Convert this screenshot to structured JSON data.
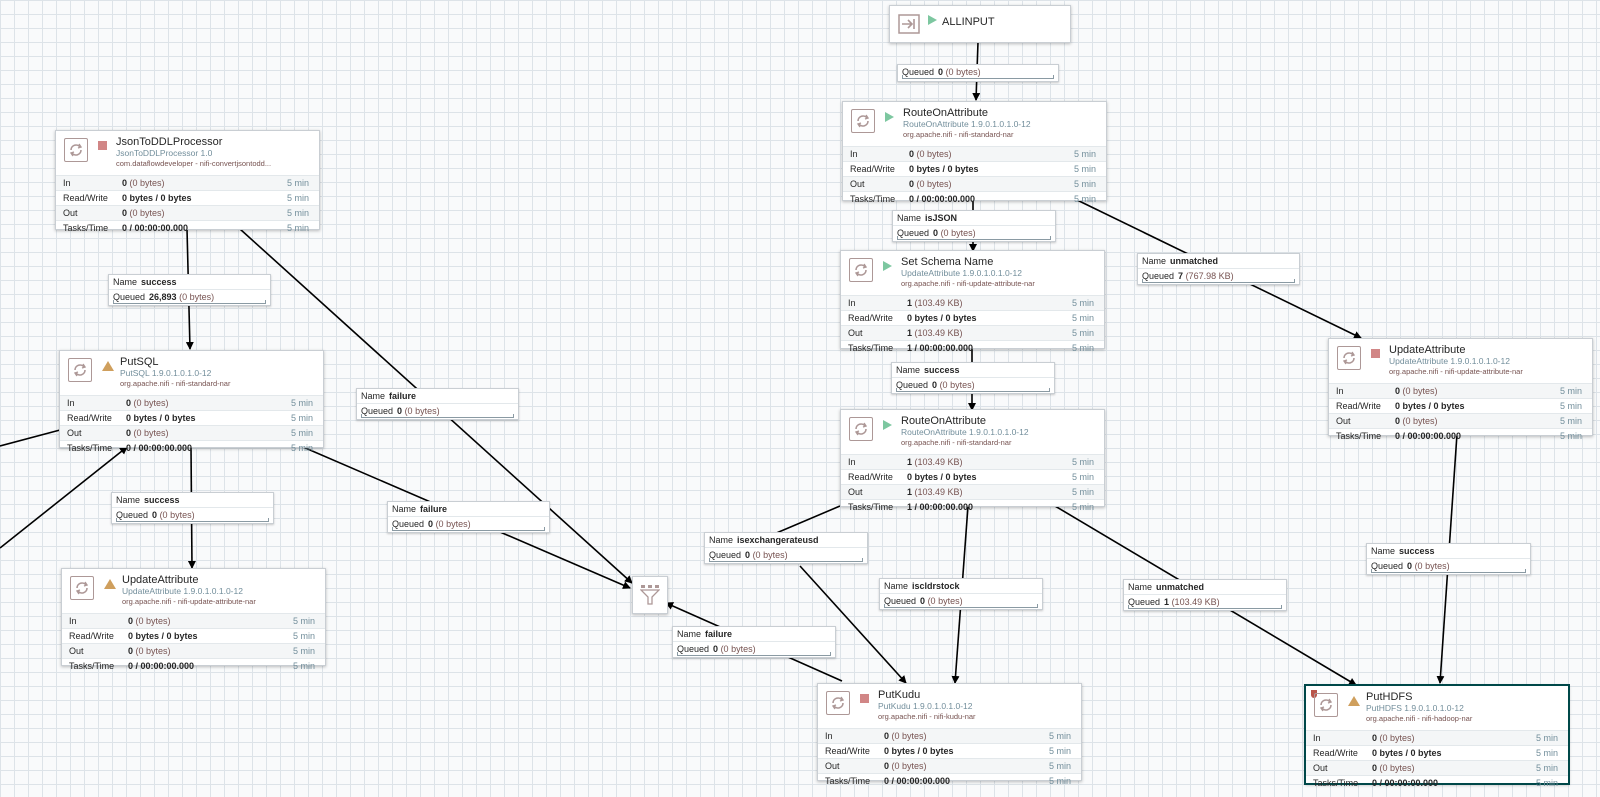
{
  "colors": {
    "running": "#7dc7a0",
    "stopped": "#d18686",
    "invalid": "#cf9f5d",
    "type_text": "#728e9b",
    "bundle_text": "#775351"
  },
  "stat_labels": {
    "in": "In",
    "rw": "Read/Write",
    "out": "Out",
    "tasks": "Tasks/Time"
  },
  "window": "5 min",
  "port_allinput": {
    "name": "ALLINPUT",
    "status": "running",
    "icon": "input-port-icon"
  },
  "processors": {
    "jsontoddl": {
      "name": "JsonToDDLProcessor",
      "status": "stopped",
      "icon": "processor-icon",
      "type": "JsonToDDLProcessor 1.0",
      "bundle": "com.dataflowdeveloper - nifi-convertjsontodd...",
      "in_count": "0",
      "in_size": "(0 bytes)",
      "rw": "0 bytes / 0 bytes",
      "out_count": "0",
      "out_size": "(0 bytes)",
      "tasks": "0 / 00:00:00.000"
    },
    "putsql": {
      "name": "PutSQL",
      "status": "invalid",
      "icon": "processor-icon",
      "type": "PutSQL 1.9.0.1.0.1.0-12",
      "bundle": "org.apache.nifi - nifi-standard-nar",
      "in_count": "0",
      "in_size": "(0 bytes)",
      "rw": "0 bytes / 0 bytes",
      "out_count": "0",
      "out_size": "(0 bytes)",
      "tasks": "0 / 00:00:00.000"
    },
    "updateattr_left": {
      "name": "UpdateAttribute",
      "status": "invalid",
      "icon": "processor-icon",
      "type": "UpdateAttribute 1.9.0.1.0.1.0-12",
      "bundle": "org.apache.nifi - nifi-update-attribute-nar",
      "in_count": "0",
      "in_size": "(0 bytes)",
      "rw": "0 bytes / 0 bytes",
      "out_count": "0",
      "out_size": "(0 bytes)",
      "tasks": "0 / 00:00:00.000"
    },
    "route1": {
      "name": "RouteOnAttribute",
      "status": "running",
      "icon": "processor-icon",
      "type": "RouteOnAttribute 1.9.0.1.0.1.0-12",
      "bundle": "org.apache.nifi - nifi-standard-nar",
      "in_count": "0",
      "in_size": "(0 bytes)",
      "rw": "0 bytes / 0 bytes",
      "out_count": "0",
      "out_size": "(0 bytes)",
      "tasks": "0 / 00:00:00.000"
    },
    "setschema": {
      "name": "Set Schema Name",
      "status": "running",
      "icon": "processor-icon",
      "type": "UpdateAttribute 1.9.0.1.0.1.0-12",
      "bundle": "org.apache.nifi - nifi-update-attribute-nar",
      "in_count": "1",
      "in_size": "(103.49 KB)",
      "rw": "0 bytes / 0 bytes",
      "out_count": "1",
      "out_size": "(103.49 KB)",
      "tasks": "1 / 00:00:00.000"
    },
    "route2": {
      "name": "RouteOnAttribute",
      "status": "running",
      "icon": "processor-icon",
      "type": "RouteOnAttribute 1.9.0.1.0.1.0-12",
      "bundle": "org.apache.nifi - nifi-standard-nar",
      "in_count": "1",
      "in_size": "(103.49 KB)",
      "rw": "0 bytes / 0 bytes",
      "out_count": "1",
      "out_size": "(103.49 KB)",
      "tasks": "1 / 00:00:00.000"
    },
    "updateattr_right": {
      "name": "UpdateAttribute",
      "status": "stopped",
      "icon": "processor-icon",
      "type": "UpdateAttribute 1.9.0.1.0.1.0-12",
      "bundle": "org.apache.nifi - nifi-update-attribute-nar",
      "in_count": "0",
      "in_size": "(0 bytes)",
      "rw": "0 bytes / 0 bytes",
      "out_count": "0",
      "out_size": "(0 bytes)",
      "tasks": "0 / 00:00:00.000"
    },
    "putkudu": {
      "name": "PutKudu",
      "status": "stopped",
      "icon": "processor-icon",
      "type": "PutKudu 1.9.0.1.0.1.0-12",
      "bundle": "org.apache.nifi - nifi-kudu-nar",
      "in_count": "0",
      "in_size": "(0 bytes)",
      "rw": "0 bytes / 0 bytes",
      "out_count": "0",
      "out_size": "(0 bytes)",
      "tasks": "0 / 00:00:00.000"
    },
    "puthdfs": {
      "name": "PutHDFS",
      "status": "invalid",
      "icon": "processor-icon",
      "type": "PutHDFS 1.9.0.1.0.1.0-12",
      "bundle": "org.apache.nifi - nifi-hadoop-nar",
      "in_count": "0",
      "in_size": "(0 bytes)",
      "rw": "0 bytes / 0 bytes",
      "out_count": "0",
      "out_size": "(0 bytes)",
      "tasks": "0 / 00:00:00.000"
    }
  },
  "connection_keys": {
    "name": "Name",
    "queued": "Queued"
  },
  "connections": {
    "c_allinput": {
      "queued": "0",
      "size": "(0 bytes)"
    },
    "c_json_success": {
      "name": "success",
      "queued": "26,893",
      "size": "(0 bytes)"
    },
    "c_json_failure": {
      "name": "failure",
      "queued": "0",
      "size": "(0 bytes)"
    },
    "c_putsql_success": {
      "name": "success",
      "queued": "0",
      "size": "(0 bytes)"
    },
    "c_putsql_failure": {
      "name": "failure",
      "queued": "0",
      "size": "(0 bytes)"
    },
    "c_isjson": {
      "name": "isJSON",
      "queued": "0",
      "size": "(0 bytes)"
    },
    "c_unmatched1": {
      "name": "unmatched",
      "queued": "7",
      "size": "(767.98 KB)"
    },
    "c_schema_success": {
      "name": "success",
      "queued": "0",
      "size": "(0 bytes)"
    },
    "c_isexchange": {
      "name": "isexchangerateusd",
      "queued": "0",
      "size": "(0 bytes)"
    },
    "c_iscldr": {
      "name": "iscldrstock",
      "queued": "0",
      "size": "(0 bytes)"
    },
    "c_unmatched2": {
      "name": "unmatched",
      "queued": "1",
      "size": "(103.49 KB)"
    },
    "c_kudu_failure": {
      "name": "failure",
      "queued": "0",
      "size": "(0 bytes)"
    },
    "c_update_success": {
      "name": "success",
      "queued": "0",
      "size": "(0 bytes)"
    }
  },
  "funnel": {
    "icon": "funnel-icon"
  }
}
